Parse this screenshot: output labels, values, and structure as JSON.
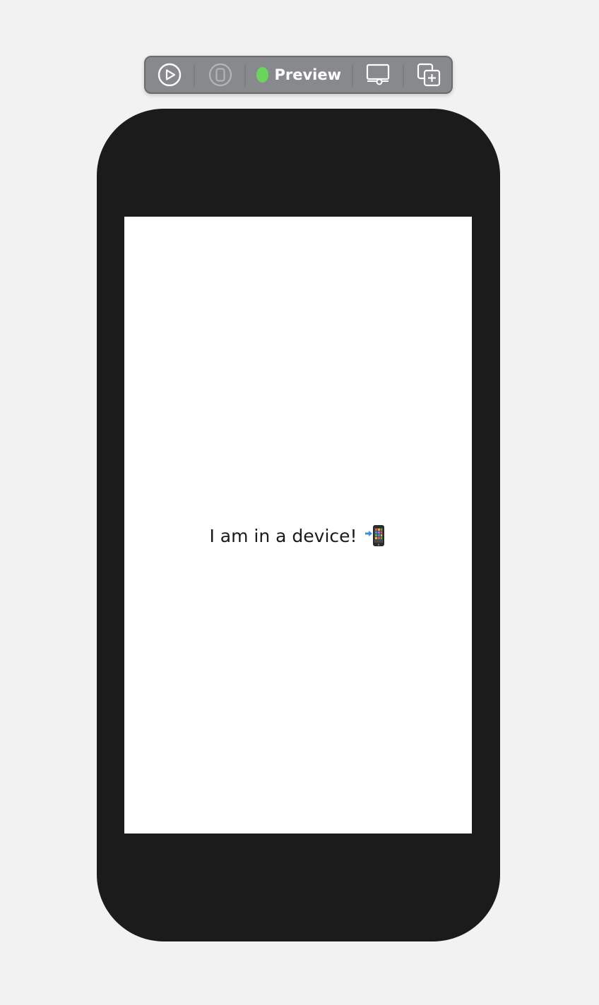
{
  "toolbar": {
    "live_icon": "play-circle-icon",
    "device_icon": "device-icon",
    "status_color": "#6bd45d",
    "preview_label": "Preview",
    "settings_icon": "device-settings-icon",
    "duplicate_icon": "duplicate-preview-icon"
  },
  "device": {
    "frame_color": "#1b1b1b",
    "screen_color": "#ffffff"
  },
  "screen": {
    "message": "I am in a device!",
    "emoji_icon": "mobile-phone-with-arrow-icon"
  }
}
